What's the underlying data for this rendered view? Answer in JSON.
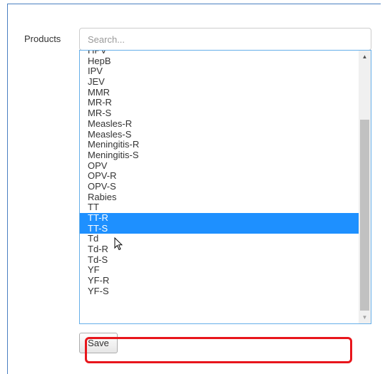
{
  "form": {
    "products_label": "Products",
    "search_placeholder": "Search...",
    "save_label": "Save"
  },
  "products_list": {
    "partial_top_item": "HPV",
    "items": [
      {
        "label": "HepB",
        "selected": false
      },
      {
        "label": "IPV",
        "selected": false
      },
      {
        "label": "JEV",
        "selected": false
      },
      {
        "label": "MMR",
        "selected": false
      },
      {
        "label": "MR-R",
        "selected": false
      },
      {
        "label": "MR-S",
        "selected": false
      },
      {
        "label": "Measles-R",
        "selected": false
      },
      {
        "label": "Measles-S",
        "selected": false
      },
      {
        "label": "Meningitis-R",
        "selected": false
      },
      {
        "label": "Meningitis-S",
        "selected": false
      },
      {
        "label": "OPV",
        "selected": false
      },
      {
        "label": "OPV-R",
        "selected": false
      },
      {
        "label": "OPV-S",
        "selected": false
      },
      {
        "label": "Rabies",
        "selected": false
      },
      {
        "label": "TT",
        "selected": false
      },
      {
        "label": "TT-R",
        "selected": true
      },
      {
        "label": "TT-S",
        "selected": true
      },
      {
        "label": "Td",
        "selected": false
      },
      {
        "label": "Td-R",
        "selected": false
      },
      {
        "label": "Td-S",
        "selected": false
      },
      {
        "label": "YF",
        "selected": false
      },
      {
        "label": "YF-R",
        "selected": false
      },
      {
        "label": "YF-S",
        "selected": false
      }
    ]
  },
  "colors": {
    "selection": "#1e90ff",
    "focus_border": "#66afe9",
    "annotation": "#e8161c"
  },
  "icons": {
    "scroll_up": "triangle-up",
    "scroll_down": "triangle-down",
    "cursor": "mouse-pointer-arrow"
  }
}
